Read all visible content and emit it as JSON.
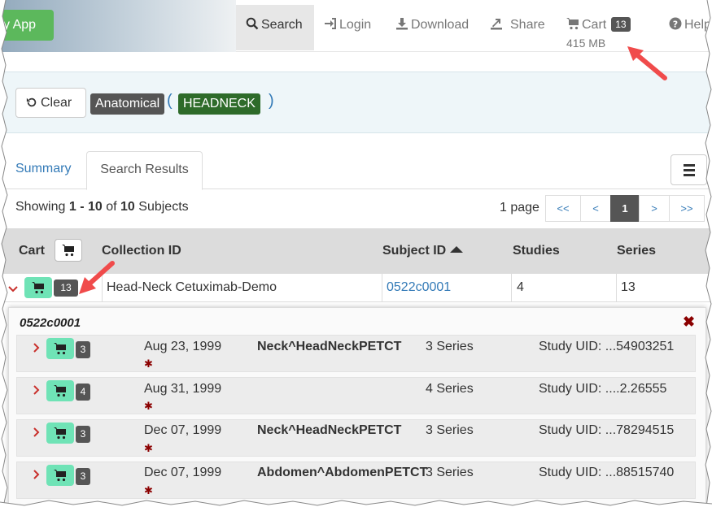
{
  "nav": {
    "app_label": "y App",
    "search": "Search",
    "login": "Login",
    "download": "Download",
    "share": "Share",
    "cart": "Cart",
    "cart_count": "13",
    "cart_size": "415 MB",
    "help": "Help"
  },
  "filters": {
    "clear_label": "Clear",
    "category": "Anatomical",
    "open_paren": "(",
    "value": "HEADNECK",
    "close_paren": ")"
  },
  "tabs": {
    "summary": "Summary",
    "results": "Search Results"
  },
  "paging": {
    "showing_prefix": "Showing",
    "range_start": "1",
    "range_sep": "-",
    "range_end": "10",
    "of": "of",
    "total": "10",
    "unit": "Subjects",
    "pages_label": "1 page",
    "buttons": [
      "<<",
      "<",
      "1",
      ">",
      ">>"
    ]
  },
  "table": {
    "columns": [
      "Cart",
      "Collection ID",
      "Subject ID",
      "Studies",
      "Series"
    ],
    "sort_column": "Subject ID",
    "sort_direction": "ascending",
    "row": {
      "cart_count": "13",
      "collection": "Head-Neck Cetuximab-Demo",
      "subject": "0522c0001",
      "studies": "4",
      "series": "13"
    }
  },
  "studies": {
    "title": "0522c0001",
    "rows": [
      {
        "count": "3",
        "date": "Aug 23, 1999",
        "desc": "Neck^HeadNeckPETCT",
        "series": "3 Series",
        "uid": "Study UID: ...54903251"
      },
      {
        "count": "4",
        "date": "Aug 31, 1999",
        "desc": "",
        "series": "4 Series",
        "uid": "Study UID: ....2.26555"
      },
      {
        "count": "3",
        "date": "Dec 07, 1999",
        "desc": "Neck^HeadNeckPETCT",
        "series": "3 Series",
        "uid": "Study UID: ...78294515"
      },
      {
        "count": "3",
        "date": "Dec 07, 1999",
        "desc": "Abdomen^AbdomenPETCT",
        "series": "3 Series",
        "uid": "Study UID: ...88515740"
      }
    ]
  },
  "colors": {
    "accent_blue": "#337ab7",
    "app_green": "#5cb85c",
    "cart_green": "#6fe3b6",
    "badge_dark": "#555555",
    "tag_green": "#2e6b2a",
    "annotation_red": "#f04b4b"
  }
}
